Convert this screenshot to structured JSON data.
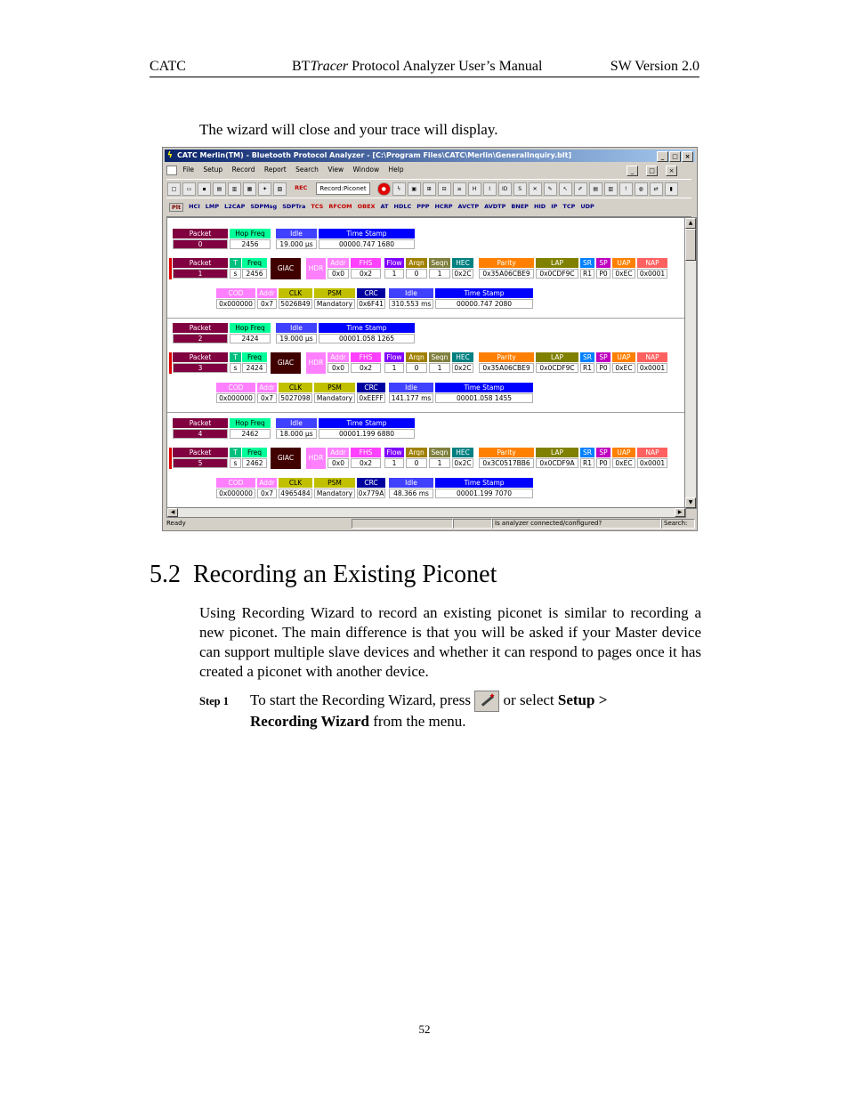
{
  "header": {
    "left": "CATC",
    "center_prefix": "BT",
    "center_italic": "Tracer",
    "center_rest": " Protocol Analyzer User’s Manual",
    "right": "SW Version 2.0"
  },
  "intro": "The wizard will close and your trace will display.",
  "app": {
    "title": "CATC Merlin(TM) - Bluetooth Protocol Analyzer - [C:\\Program Files\\CATC\\Merlin\\GeneralInquiry.blt]",
    "window_buttons": [
      "_",
      "□",
      "×"
    ],
    "menu": [
      "File",
      "Setup",
      "Record",
      "Report",
      "Search",
      "View",
      "Window",
      "Help"
    ],
    "record_select": "Record:Piconet",
    "rec_label": "REC",
    "toolbar2": [
      "Plt",
      "HCI",
      "LMP",
      "L2CAP",
      "SDPMsg",
      "SDPTra",
      "TCS",
      "RFCOM",
      "OBEX",
      "AT",
      "HDLC",
      "PPP",
      "HCRP",
      "AVCTP",
      "AVDTP",
      "BNEP",
      "HID",
      "IP",
      "TCP",
      "UDP"
    ],
    "status_ready": "Ready",
    "status_msg": "Is analyzer connected/configured?",
    "status_search": "Search:",
    "colors": {
      "packet": "#800040",
      "hopfreq": "#00ff99",
      "idle": "#4040ff",
      "timestamp": "#0000ff",
      "ts_bits": "#008000",
      "giac": "#400000",
      "hdr": "#ff80ff",
      "addr": "#ff80ff",
      "fhs": "#ff40ff",
      "flow": "#8000ff",
      "arqn": "#a08000",
      "seqn": "#808040",
      "hec": "#008080",
      "parity": "#ff8000",
      "lap": "#808000",
      "sr": "#0080ff",
      "sp": "#c000c0",
      "uap": "#ff8000",
      "nap": "#ff6060",
      "cod": "#ff80ff",
      "clk": "#c0c000",
      "psm": "#c0c000",
      "crc": "#0000a0"
    }
  },
  "trace": {
    "labels": {
      "packet": "Packet",
      "hopfreq": "Hop Freq",
      "idle": "Idle",
      "timestamp": "Time Stamp",
      "t": "T",
      "s": "s",
      "freq": "Freq",
      "giac": "GIAC",
      "hdr": "HDR",
      "addr": "Addr",
      "fhs": "FHS",
      "flow": "Flow",
      "arqn": "Arqn",
      "seqn": "Seqn",
      "hec": "HEC",
      "parity": "Parity",
      "lap": "LAP",
      "sr": "SR",
      "sp": "SP",
      "uap": "UAP",
      "nap": "NAP",
      "cod": "COD",
      "clk": "CLK",
      "psm": "PSM",
      "crc": "CRC"
    },
    "groups": [
      {
        "idpkt": {
          "num": "0",
          "freq": "2456",
          "idle": "19.000 µs",
          "ts": "00000.747 1680"
        },
        "fhspkt": {
          "num": "1",
          "freq": "2456",
          "addr": "0x0",
          "fhs": "0x2",
          "flow": "1",
          "arqn": "0",
          "seqn": "1",
          "hec": "0x2C",
          "parity": "0x35A06CBE9",
          "lap": "0x0CDF9C",
          "sr": "R1",
          "sp": "P0",
          "uap": "0xEC",
          "nap": "0x0001"
        },
        "fhs2": {
          "cod": "0x000000",
          "addr": "0x7",
          "clk": "5026849",
          "psm": "Mandatory",
          "crc": "0x6F41",
          "idle": "310.553 ms",
          "ts": "00000.747 2080"
        }
      },
      {
        "idpkt": {
          "num": "2",
          "freq": "2424",
          "idle": "19.000 µs",
          "ts": "00001.058 1265"
        },
        "fhspkt": {
          "num": "3",
          "freq": "2424",
          "addr": "0x0",
          "fhs": "0x2",
          "flow": "1",
          "arqn": "0",
          "seqn": "1",
          "hec": "0x2C",
          "parity": "0x35A06CBE9",
          "lap": "0x0CDF9C",
          "sr": "R1",
          "sp": "P0",
          "uap": "0xEC",
          "nap": "0x0001"
        },
        "fhs2": {
          "cod": "0x000000",
          "addr": "0x7",
          "clk": "5027098",
          "psm": "Mandatory",
          "crc": "0xEEFF",
          "idle": "141.177 ms",
          "ts": "00001.058 1455"
        }
      },
      {
        "idpkt": {
          "num": "4",
          "freq": "2462",
          "idle": "18.000 µs",
          "ts": "00001.199 6880"
        },
        "fhspkt": {
          "num": "5",
          "freq": "2462",
          "addr": "0x0",
          "fhs": "0x2",
          "flow": "1",
          "arqn": "0",
          "seqn": "1",
          "hec": "0x2C",
          "parity": "0x3C0517BB6",
          "lap": "0x0CDF9A",
          "sr": "R1",
          "sp": "P0",
          "uap": "0xEC",
          "nap": "0x0001"
        },
        "fhs2": {
          "cod": "0x000000",
          "addr": "0x7",
          "clk": "4965484",
          "psm": "Mandatory",
          "crc": "0x779A",
          "idle": "48.366 ms",
          "ts": "00001.199 7070"
        }
      }
    ]
  },
  "section": {
    "number": "5.2",
    "title": "Recording an Existing Piconet"
  },
  "paragraph": "Using Recording Wizard to record an existing piconet is similar to recording a new piconet.  The main difference is that you will be asked if your Master device can support multiple slave devices and whether it can respond to pages once it has created a piconet with another device.",
  "step": {
    "label": "Step 1",
    "text_before": "To start the Recording Wizard, press ",
    "text_mid": " or select ",
    "bold1": "Setup >",
    "bold2": "Recording Wizard",
    "text_after": " from the menu."
  },
  "page_number": "52"
}
